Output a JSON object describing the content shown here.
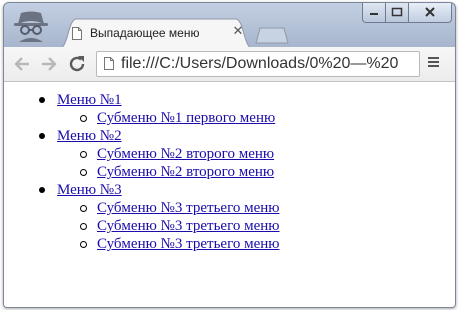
{
  "browser": {
    "tab": {
      "title": "Выпадающее меню"
    },
    "address_bar": {
      "url": "file:///C:/Users/Downloads/0%20—%20"
    }
  },
  "page": {
    "menu": [
      {
        "label": "Меню №1",
        "submenu": [
          "Субменю №1 первого меню"
        ]
      },
      {
        "label": "Меню №2",
        "submenu": [
          "Субменю №2 второго меню",
          "Субменю №2 второго меню"
        ]
      },
      {
        "label": "Меню №3",
        "submenu": [
          "Субменю №3 третьего меню",
          "Субменю №3 третьего меню",
          "Субменю №3 третьего меню"
        ]
      }
    ]
  },
  "icons": [
    "incognito-icon",
    "page-icon",
    "close-icon",
    "new-tab-icon",
    "minimize-icon",
    "maximize-icon",
    "window-close-icon",
    "back-icon",
    "forward-icon",
    "reload-icon",
    "menu-icon"
  ],
  "colors": {
    "link": "#1a0dab",
    "frame": "#a9b6cb"
  }
}
